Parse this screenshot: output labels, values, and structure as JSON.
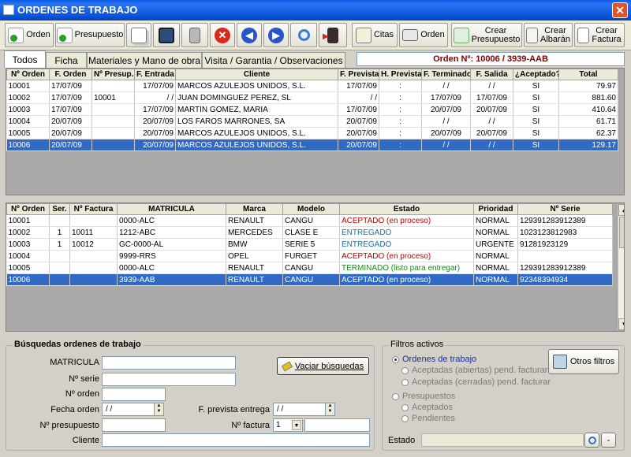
{
  "window": {
    "title": "ORDENES DE TRABAJO",
    "close_label": "✕"
  },
  "toolbar": {
    "orden_label": "Orden",
    "presupuesto_label": "Presupuesto",
    "citas_label": "Citas",
    "orden_print_label": "Orden",
    "crear_presupuesto_label": "Crear\nPresupuesto",
    "crear_albaran_label": "Crear\nAlbarán",
    "crear_factura_label": "Crear\nFactura"
  },
  "tabs": [
    "Todos",
    "Ficha",
    "Materiales y Mano de obra",
    "Visita / Garantia / Observaciones"
  ],
  "orden_header": "Orden Nº: 10006 / 3939-AAB",
  "top_grid": {
    "headers": [
      "Nº Orden",
      "F. Orden",
      "Nº Presup.",
      "F. Entrada",
      "Cliente",
      "F. Prevista",
      "H. Prevista",
      "F. Terminado",
      "F. Salida",
      "¿Aceptado?",
      "Total"
    ],
    "rows": [
      [
        "10001",
        "17/07/09",
        "",
        "17/07/09",
        "MARCOS AZULEJOS UNIDOS, S.L.",
        "17/07/09",
        ":",
        "/ /",
        "/ /",
        "SI",
        "79.97"
      ],
      [
        "10002",
        "17/07/09",
        "10001",
        "/ /",
        "JUAN DOMINGUEZ PEREZ, SL",
        "/ /",
        ":",
        "17/07/09",
        "17/07/09",
        "SI",
        "881.60"
      ],
      [
        "10003",
        "17/07/09",
        "",
        "17/07/09",
        "MARTIN GOMEZ, MARIA",
        "17/07/09",
        ":",
        "20/07/09",
        "20/07/09",
        "SI",
        "410.64"
      ],
      [
        "10004",
        "20/07/09",
        "",
        "20/07/09",
        "LOS FAROS MARRONES, SA",
        "20/07/09",
        ":",
        "/ /",
        "/ /",
        "SI",
        "61.71"
      ],
      [
        "10005",
        "20/07/09",
        "",
        "20/07/09",
        "MARCOS AZULEJOS UNIDOS, S.L.",
        "20/07/09",
        ":",
        "20/07/09",
        "20/07/09",
        "SI",
        "62.37"
      ],
      [
        "10006",
        "20/07/09",
        "",
        "20/07/09",
        "MARCOS AZULEJOS UNIDOS, S.L.",
        "20/07/09",
        ":",
        "/ /",
        "/ /",
        "SI",
        "129.17"
      ]
    ],
    "selected_row": 5
  },
  "bottom_grid": {
    "headers": [
      "Nº Orden",
      "Ser.",
      "Nº Factura",
      "MATRICULA",
      "Marca",
      "Modelo",
      "Estado",
      "Prioridad",
      "Nº Serie"
    ],
    "rows": [
      [
        "10001",
        "",
        "",
        "0000-ALC",
        "RENAULT",
        "CANGU",
        "ACEPTADO (en proceso)",
        "NORMAL",
        "129391283912389"
      ],
      [
        "10002",
        "1",
        "10011",
        "1212-ABC",
        "MERCEDES",
        "CLASE E",
        "ENTREGADO",
        "NORMAL",
        "1023123812983"
      ],
      [
        "10003",
        "1",
        "10012",
        "GC-0000-AL",
        "BMW",
        "SERIE 5",
        "ENTREGADO",
        "URGENTE",
        "91281923129"
      ],
      [
        "10004",
        "",
        "",
        "9999-RRS",
        "OPEL",
        "FURGET",
        "ACEPTADO (en proceso)",
        "NORMAL",
        ""
      ],
      [
        "10005",
        "",
        "",
        "0000-ALC",
        "RENAULT",
        "CANGU",
        "TERMINADO (listo para entregar)",
        "NORMAL",
        "129391283912389"
      ],
      [
        "10006",
        "",
        "",
        "3939-AAB",
        "RENAULT",
        "CANGU",
        "ACEPTADO (en proceso)",
        "NORMAL",
        "92348394934"
      ]
    ],
    "estado_colors": [
      "red",
      "blue",
      "blue",
      "red",
      "green",
      "red"
    ],
    "selected_row": 5
  },
  "search": {
    "title": "Búsquedas ordenes de trabajo",
    "matricula_label": "MATRICULA",
    "serie_label": "Nº serie",
    "orden_label": "Nº orden",
    "fecha_orden_label": "Fecha orden",
    "fecha_orden_value": "/ /",
    "f_prevista_label": "F. prevista entrega",
    "f_prevista_value": "/ /",
    "presupuesto_label": "Nº presupuesto",
    "factura_label": "Nº factura",
    "factura_value": "1",
    "cliente_label": "Cliente",
    "vaciar_label": "Vaciar búsquedas"
  },
  "filters": {
    "title": "Filtros activos",
    "ordenes_label": "Ordenes de trabajo",
    "abiertas_label": "Aceptadas (abiertas) pend. facturar",
    "cerradas_label": "Aceptadas (cerradas) pend. facturar",
    "presupuestos_label": "Presupuestos",
    "aceptados_label": "Aceptados",
    "pendientes_label": "Pendientes",
    "otros_label": "Otros filtros",
    "estado_label": "Estado",
    "minus_label": "-"
  },
  "colors": {
    "accent": "#316ac5",
    "title_blue": "#0a5be6",
    "order_header": "#800000"
  }
}
